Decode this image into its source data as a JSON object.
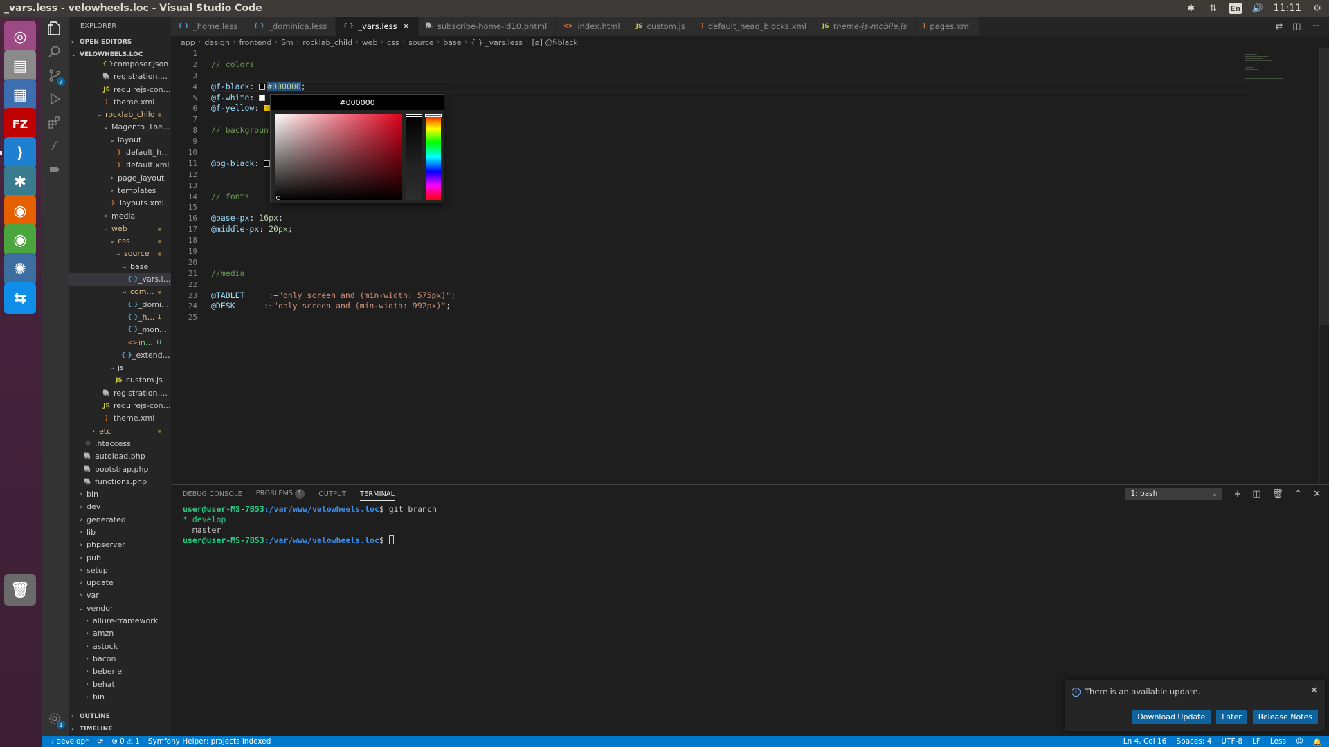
{
  "window": {
    "title": "_vars.less - velowheels.loc - Visual Studio Code",
    "clock": "11:11",
    "keyboard_layout": "En"
  },
  "launcher": {
    "apps": [
      {
        "name": "ubuntu-dash",
        "glyph": "◎",
        "bg": "#9c4a83"
      },
      {
        "name": "files",
        "glyph": "▤",
        "bg": "#8a8a8a"
      },
      {
        "name": "document-viewer",
        "glyph": "▦",
        "bg": "#3d6fb0"
      },
      {
        "name": "filezilla",
        "glyph": "FZ",
        "bg": "#bf0000"
      },
      {
        "name": "vscode",
        "glyph": "⟩",
        "bg": "#1f7fd1"
      },
      {
        "name": "slack",
        "glyph": "✱",
        "bg": "#3a7c8f"
      },
      {
        "name": "firefox",
        "glyph": "◉",
        "bg": "#e66000"
      },
      {
        "name": "chrome",
        "glyph": "◉",
        "bg": "#4aa53f"
      },
      {
        "name": "sublime-merge",
        "glyph": "✺",
        "bg": "#3c6ea0"
      },
      {
        "name": "teamviewer",
        "glyph": "⇆",
        "bg": "#0e8ee9"
      },
      {
        "name": "trash",
        "glyph": "🗑",
        "bg": "#6a6a6a"
      }
    ]
  },
  "activity_bar": {
    "source_control_badge": "7",
    "settings_badge": "1"
  },
  "sidebar": {
    "header": "EXPLORER",
    "open_editors": "OPEN EDITORS",
    "root": "VELOWHEELS.LOC",
    "outline": "OUTLINE",
    "timeline": "TIMELINE",
    "tree": [
      {
        "label": "composer.json",
        "indent": 5,
        "type": "json",
        "icon": "{ }"
      },
      {
        "label": "registration.php",
        "indent": 5,
        "type": "php",
        "icon": "🐘"
      },
      {
        "label": "requirejs-confi...",
        "indent": 5,
        "type": "js",
        "icon": "JS"
      },
      {
        "label": "theme.xml",
        "indent": 5,
        "type": "xml",
        "icon": "⟩"
      },
      {
        "label": "rocklab_child",
        "indent": 4,
        "type": "folder-open",
        "status": "mod"
      },
      {
        "label": "Magento_Theme",
        "indent": 5,
        "type": "folder-open"
      },
      {
        "label": "layout",
        "indent": 6,
        "type": "folder-open"
      },
      {
        "label": "default_hea...",
        "indent": 7,
        "type": "xml",
        "icon": "⟩"
      },
      {
        "label": "default.xml",
        "indent": 7,
        "type": "xml",
        "icon": "⟩"
      },
      {
        "label": "page_layout",
        "indent": 6,
        "type": "folder"
      },
      {
        "label": "templates",
        "indent": 6,
        "type": "folder"
      },
      {
        "label": "layouts.xml",
        "indent": 6,
        "type": "xml",
        "icon": "⟩"
      },
      {
        "label": "media",
        "indent": 5,
        "type": "folder"
      },
      {
        "label": "web",
        "indent": 5,
        "type": "folder-open",
        "status": "mod"
      },
      {
        "label": "css",
        "indent": 6,
        "type": "folder-open",
        "status": "mod"
      },
      {
        "label": "source",
        "indent": 7,
        "type": "folder-open",
        "status": "mod"
      },
      {
        "label": "base",
        "indent": 8,
        "type": "folder-open"
      },
      {
        "label": "_vars.less",
        "indent": 9,
        "type": "less",
        "icon": "{ }",
        "selected": true
      },
      {
        "label": "comp...",
        "indent": 8,
        "type": "folder-open",
        "status": "mod"
      },
      {
        "label": "_dominic...",
        "indent": 9,
        "type": "less",
        "icon": "{ }"
      },
      {
        "label": "_ho...",
        "indent": 9,
        "type": "less",
        "icon": "{ }",
        "status": "mod",
        "mark": "1"
      },
      {
        "label": "_mongoli...",
        "indent": 9,
        "type": "less",
        "icon": "{ }"
      },
      {
        "label": "inde...",
        "indent": 9,
        "type": "html",
        "icon": "<>",
        "status": "new",
        "mark": "U"
      },
      {
        "label": "_extend.less",
        "indent": 8,
        "type": "less",
        "icon": "{ }"
      },
      {
        "label": "js",
        "indent": 6,
        "type": "folder-open"
      },
      {
        "label": "custom.js",
        "indent": 7,
        "type": "js",
        "icon": "JS"
      },
      {
        "label": "registration.php",
        "indent": 5,
        "type": "php",
        "icon": "🐘"
      },
      {
        "label": "requirejs-confi...",
        "indent": 5,
        "type": "js",
        "icon": "JS"
      },
      {
        "label": "theme.xml",
        "indent": 5,
        "type": "xml",
        "icon": "⟩"
      },
      {
        "label": "etc",
        "indent": 3,
        "type": "folder",
        "status": "mod"
      },
      {
        "label": ".htaccess",
        "indent": 2,
        "type": "gear",
        "icon": "⚙"
      },
      {
        "label": "autoload.php",
        "indent": 2,
        "type": "php",
        "icon": "🐘"
      },
      {
        "label": "bootstrap.php",
        "indent": 2,
        "type": "php",
        "icon": "🐘"
      },
      {
        "label": "functions.php",
        "indent": 2,
        "type": "php",
        "icon": "🐘"
      },
      {
        "label": "bin",
        "indent": 1,
        "type": "folder"
      },
      {
        "label": "dev",
        "indent": 1,
        "type": "folder"
      },
      {
        "label": "generated",
        "indent": 1,
        "type": "folder"
      },
      {
        "label": "lib",
        "indent": 1,
        "type": "folder"
      },
      {
        "label": "phpserver",
        "indent": 1,
        "type": "folder"
      },
      {
        "label": "pub",
        "indent": 1,
        "type": "folder"
      },
      {
        "label": "setup",
        "indent": 1,
        "type": "folder"
      },
      {
        "label": "update",
        "indent": 1,
        "type": "folder"
      },
      {
        "label": "var",
        "indent": 1,
        "type": "folder"
      },
      {
        "label": "vendor",
        "indent": 1,
        "type": "folder-open"
      },
      {
        "label": "allure-framework",
        "indent": 2,
        "type": "folder"
      },
      {
        "label": "amzn",
        "indent": 2,
        "type": "folder"
      },
      {
        "label": "astock",
        "indent": 2,
        "type": "folder"
      },
      {
        "label": "bacon",
        "indent": 2,
        "type": "folder"
      },
      {
        "label": "beberlei",
        "indent": 2,
        "type": "folder"
      },
      {
        "label": "behat",
        "indent": 2,
        "type": "folder"
      },
      {
        "label": "bin",
        "indent": 2,
        "type": "folder"
      }
    ]
  },
  "tabs": [
    {
      "label": "_home.less",
      "type": "less",
      "icon": "{ }"
    },
    {
      "label": "_dominica.less",
      "type": "less",
      "icon": "{ }"
    },
    {
      "label": "_vars.less",
      "type": "less",
      "icon": "{ }",
      "active": true
    },
    {
      "label": "subscribe-home-id10.phtml",
      "type": "php",
      "icon": "🐘"
    },
    {
      "label": "index.html",
      "type": "html",
      "icon": "<>"
    },
    {
      "label": "custom.js",
      "type": "js",
      "icon": "JS"
    },
    {
      "label": "default_head_blocks.xml",
      "type": "xml",
      "icon": "⟩"
    },
    {
      "label": "theme-js-mobile.js",
      "type": "js",
      "icon": "JS",
      "italic": true
    },
    {
      "label": "pages.xml",
      "type": "xml",
      "icon": "⟩"
    }
  ],
  "breadcrumb": [
    "app",
    "design",
    "frontend",
    "Sm",
    "rocklab_child",
    "web",
    "css",
    "source",
    "base",
    "{ } _vars.less",
    "[ø] @f-black"
  ],
  "editor": {
    "line_numbers": [
      "1",
      "2",
      "3",
      "4",
      "5",
      "6",
      "7",
      "8",
      "9",
      "10",
      "11",
      "12",
      "13",
      "14",
      "15",
      "16",
      "17",
      "18",
      "19",
      "20",
      "21",
      "22",
      "23",
      "24",
      "25"
    ],
    "lines": [
      [],
      [
        {
          "t": "// colors",
          "c": "comment"
        }
      ],
      [],
      [
        {
          "t": "@f-black",
          "c": "var"
        },
        {
          "t": ": ",
          "c": "plain"
        },
        {
          "swatch": "#000000"
        },
        {
          "t": "#000000",
          "c": "num",
          "sel": true
        },
        {
          "t": ";",
          "c": "plain"
        }
      ],
      [
        {
          "t": "@f-white",
          "c": "var"
        },
        {
          "t": ": ",
          "c": "plain"
        },
        {
          "swatch": "#ffffff"
        }
      ],
      [
        {
          "t": "@f-yellow",
          "c": "var"
        },
        {
          "t": ": ",
          "c": "plain"
        },
        {
          "swatch": "#f5c400"
        }
      ],
      [],
      [
        {
          "t": "// backgroun",
          "c": "comment"
        }
      ],
      [],
      [],
      [
        {
          "t": "@bg-black",
          "c": "var"
        },
        {
          "t": ": ",
          "c": "plain"
        },
        {
          "swatch": "#000000"
        }
      ],
      [],
      [],
      [
        {
          "t": "// fonts",
          "c": "comment"
        }
      ],
      [],
      [
        {
          "t": "@base-px",
          "c": "var"
        },
        {
          "t": ": ",
          "c": "plain"
        },
        {
          "t": "16px",
          "c": "num"
        },
        {
          "t": ";",
          "c": "plain"
        }
      ],
      [
        {
          "t": "@middle-px",
          "c": "var"
        },
        {
          "t": ": ",
          "c": "plain"
        },
        {
          "t": "20px",
          "c": "num"
        },
        {
          "t": ";",
          "c": "plain"
        }
      ],
      [],
      [],
      [],
      [
        {
          "t": "//media",
          "c": "comment"
        }
      ],
      [],
      [
        {
          "t": "@TABLET",
          "c": "var"
        },
        {
          "t": "     :~",
          "c": "plain"
        },
        {
          "t": "\"only screen and (min-width: 575px)\"",
          "c": "str"
        },
        {
          "t": ";",
          "c": "plain"
        }
      ],
      [
        {
          "t": "@DESK",
          "c": "var"
        },
        {
          "t": "      :~",
          "c": "plain"
        },
        {
          "t": "\"only screen and (min-width: 992px)\"",
          "c": "str"
        },
        {
          "t": ";",
          "c": "plain"
        }
      ],
      []
    ]
  },
  "color_picker": {
    "value": "#000000"
  },
  "panel": {
    "tabs": [
      "DEBUG CONSOLE",
      "PROBLEMS",
      "OUTPUT",
      "TERMINAL"
    ],
    "problems_count": "1",
    "active_tab": "TERMINAL",
    "terminal_select": "1: bash",
    "terminal": {
      "user": "user@user-MS-7B53",
      "path": ":/var/www/velowheels.loc",
      "command": "$ git branch",
      "branch_current": "* develop",
      "branch_other": "  master",
      "prompt_end": "$ "
    }
  },
  "notification": {
    "message": "There is an available update.",
    "buttons": [
      "Download Update",
      "Later",
      "Release Notes"
    ]
  },
  "statusbar": {
    "branch": "develop*",
    "errors": "0",
    "warnings": "1",
    "extension": "Symfony Helper: projects indexed",
    "position": "Ln 4, Col 16",
    "spaces": "Spaces: 4",
    "encoding": "UTF-8",
    "eol": "LF",
    "language": "Less"
  }
}
